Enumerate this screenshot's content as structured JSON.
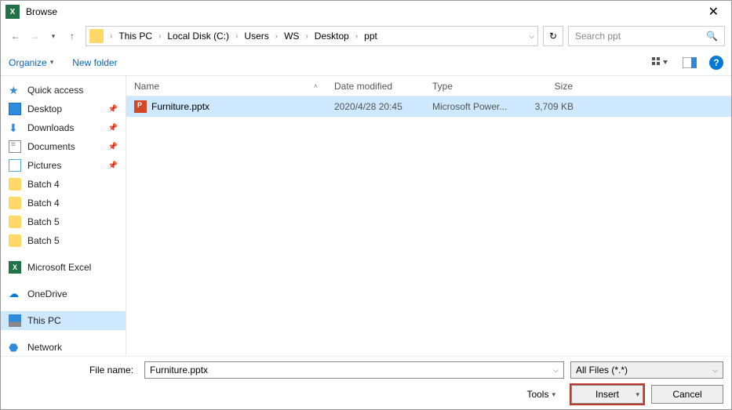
{
  "window": {
    "title": "Browse"
  },
  "nav": {
    "back_enabled": true,
    "forward_enabled": false
  },
  "breadcrumb": {
    "items": [
      "This PC",
      "Local Disk (C:)",
      "Users",
      "WS",
      "Desktop",
      "ppt"
    ]
  },
  "search": {
    "placeholder": "Search ppt"
  },
  "toolbar": {
    "organize": "Organize",
    "new_folder": "New folder"
  },
  "sidebar": {
    "items": [
      {
        "label": "Quick access",
        "icon": "star",
        "pinned": false
      },
      {
        "label": "Desktop",
        "icon": "desktop",
        "pinned": true
      },
      {
        "label": "Downloads",
        "icon": "down",
        "pinned": true
      },
      {
        "label": "Documents",
        "icon": "doc",
        "pinned": true
      },
      {
        "label": "Pictures",
        "icon": "pic",
        "pinned": true
      },
      {
        "label": "Batch 4",
        "icon": "folder",
        "pinned": false
      },
      {
        "label": "Batch 4",
        "icon": "folder",
        "pinned": false
      },
      {
        "label": "Batch 5",
        "icon": "folder",
        "pinned": false
      },
      {
        "label": "Batch 5",
        "icon": "folder",
        "pinned": false
      },
      {
        "label": "Microsoft Excel",
        "icon": "excel",
        "pinned": false,
        "gap": true
      },
      {
        "label": "OneDrive",
        "icon": "cloud",
        "pinned": false,
        "gap": true
      },
      {
        "label": "This PC",
        "icon": "pc",
        "pinned": false,
        "selected": true,
        "gap": true
      },
      {
        "label": "Network",
        "icon": "net",
        "pinned": false,
        "gap": true
      }
    ]
  },
  "columns": {
    "name": "Name",
    "date": "Date modified",
    "type": "Type",
    "size": "Size"
  },
  "files": [
    {
      "name": "Furniture.pptx",
      "date": "2020/4/28 20:45",
      "type": "Microsoft Power...",
      "size": "3,709 KB",
      "selected": true,
      "icon": "ppt"
    }
  ],
  "bottom": {
    "filename_label": "File name:",
    "filename_value": "Furniture.pptx",
    "filter": "All Files (*.*)",
    "tools": "Tools",
    "insert": "Insert",
    "cancel": "Cancel"
  }
}
